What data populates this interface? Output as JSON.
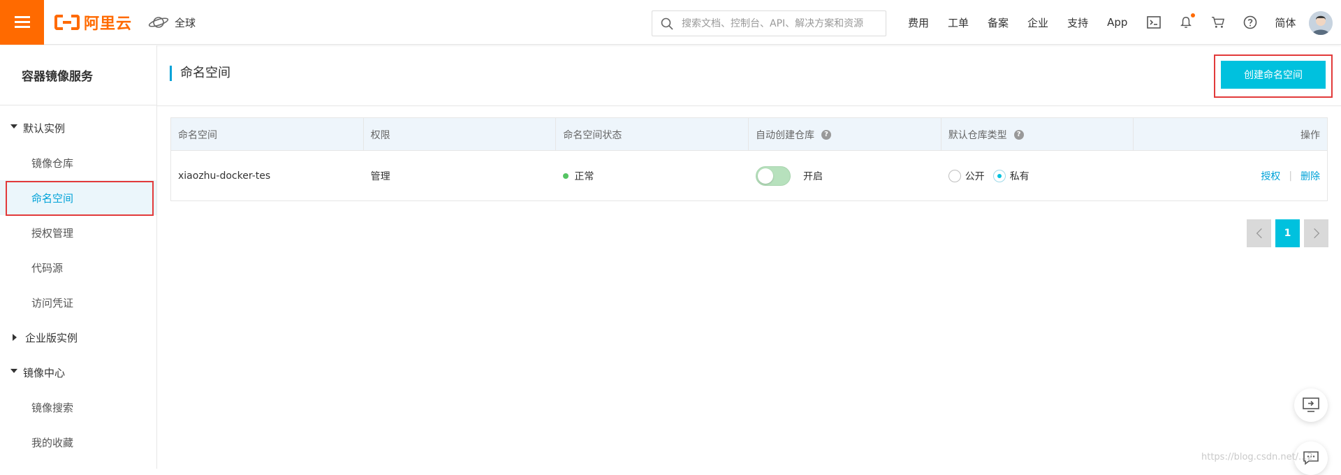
{
  "topbar": {
    "brand": "阿里云",
    "region": "全球",
    "search_placeholder": "搜索文档、控制台、API、解决方案和资源",
    "nav": [
      "费用",
      "工单",
      "备案",
      "企业",
      "支持",
      "App"
    ],
    "lang": "简体",
    "accent": "#ff6a00"
  },
  "sidebar": {
    "title": "容器镜像服务",
    "group_default": "默认实例",
    "items_default": [
      "镜像仓库",
      "命名空间",
      "授权管理",
      "代码源",
      "访问凭证"
    ],
    "group_enterprise": "企业版实例",
    "group_center": "镜像中心",
    "items_center": [
      "镜像搜索",
      "我的收藏"
    ]
  },
  "main": {
    "page_title": "命名空间",
    "create_button": "创建命名空间",
    "columns": [
      "命名空间",
      "权限",
      "命名空间状态",
      "自动创建仓库",
      "默认仓库类型",
      "操作"
    ],
    "row": {
      "namespace": "xiaozhu-docker-tes",
      "permission": "管理",
      "status": "正常",
      "auto_create": "开启",
      "repo_type_public": "公开",
      "repo_type_private": "私有",
      "action_auth": "授权",
      "action_delete": "删除"
    },
    "pager": {
      "current": "1"
    }
  },
  "watermark": "https://blog.csdn.net/...2",
  "colors": {
    "primary": "#00c1de",
    "link": "#00a2d8",
    "highlight": "#e23a3a"
  }
}
